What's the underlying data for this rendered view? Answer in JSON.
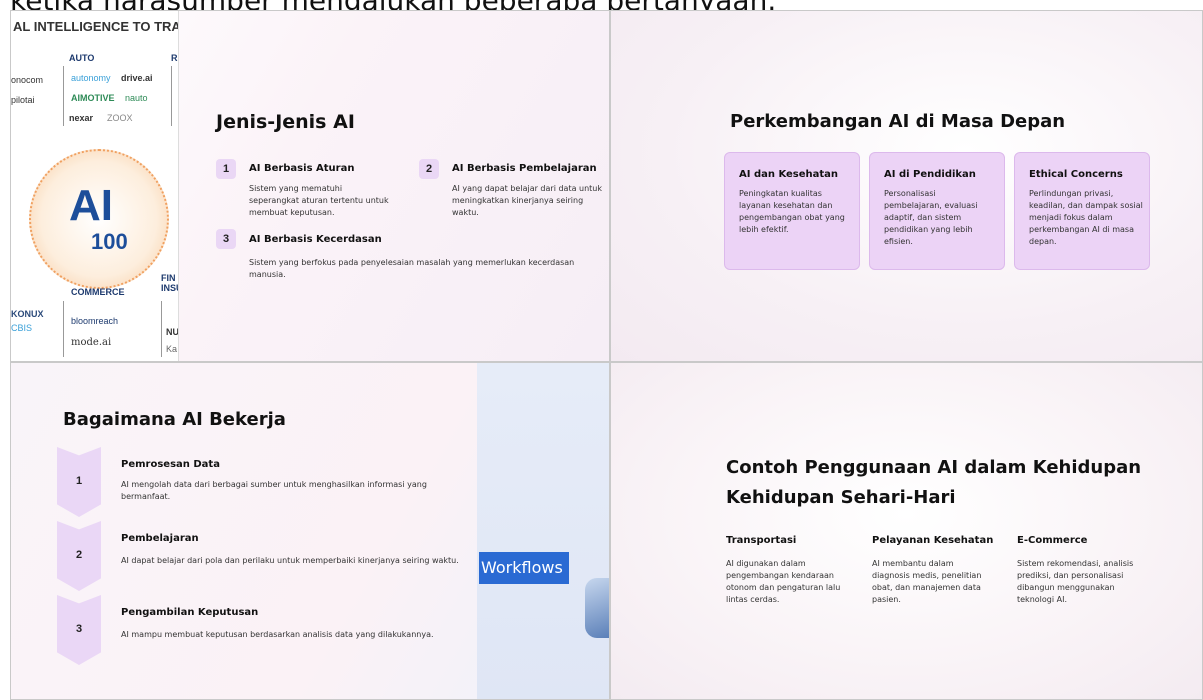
{
  "caption": "ketika narasumber mengajukan beberapa pertanyaan.",
  "slide1": {
    "image": {
      "header": "AL INTELLIGENCE TO TRA",
      "cat_auto": "AUTO",
      "cat_r": "R",
      "cat_commerce": "COMMERCE",
      "cat_fin": "FIN",
      "cat_ins": "INSU",
      "logos": [
        "onocom",
        "pilotai",
        "nexar",
        "autonomy",
        "AIMOTIVE",
        "drive.ai",
        "nauto",
        "ZOOX",
        "KONUX",
        "CBIS",
        "bloomreach",
        "mode.ai",
        "NU",
        "Ka"
      ],
      "ai": "AI",
      "hundred": "100"
    },
    "title": "Jenis-Jenis AI",
    "items": [
      {
        "num": "1",
        "heading": "AI Berbasis Aturan",
        "text": "Sistem yang mematuhi seperangkat aturan tertentu untuk membuat keputusan."
      },
      {
        "num": "2",
        "heading": "AI Berbasis Pembelajaran",
        "text": "AI yang dapat belajar dari data untuk meningkatkan kinerjanya seiring waktu."
      },
      {
        "num": "3",
        "heading": "AI Berbasis Kecerdasan",
        "text": "Sistem yang berfokus pada penyelesaian masalah yang memerlukan kecerdasan manusia."
      }
    ]
  },
  "slide2": {
    "title": "Perkembangan AI di Masa Depan",
    "cards": [
      {
        "heading": "AI dan Kesehatan",
        "text": "Peningkatan kualitas layanan kesehatan dan pengembangan obat yang lebih efektif."
      },
      {
        "heading": "AI di Pendidikan",
        "text": "Personalisasi pembelajaran, evaluasi adaptif, dan sistem pendidikan yang lebih efisien."
      },
      {
        "heading": "Ethical Concerns",
        "text": "Perlindungan privasi, keadilan, dan dampak sosial menjadi fokus dalam perkembangan AI di masa depan."
      }
    ]
  },
  "slide3": {
    "title": "Bagaimana AI Bekerja",
    "steps": [
      {
        "num": "1",
        "heading": "Pemrosesan Data",
        "text": "AI mengolah data dari berbagai sumber untuk menghasilkan informasi yang bermanfaat."
      },
      {
        "num": "2",
        "heading": "Pembelajaran",
        "text": "AI dapat belajar dari pola dan perilaku untuk memperbaiki kinerjanya seiring waktu."
      },
      {
        "num": "3",
        "heading": "Pengambilan Keputusan",
        "text": "AI mampu membuat keputusan berdasarkan analisis data yang dilakukannya."
      }
    ],
    "badge": "Workflows"
  },
  "slide4": {
    "title_line1": "Contoh Penggunaan AI dalam Kehidupan",
    "title_line2": "Kehidupan Sehari-Hari",
    "columns": [
      {
        "heading": "Transportasi",
        "text": "AI digunakan dalam pengembangan kendaraan otonom dan pengaturan lalu lintas cerdas."
      },
      {
        "heading": "Pelayanan Kesehatan",
        "text": "AI membantu dalam diagnosis medis, penelitian obat, dan manajemen data pasien."
      },
      {
        "heading": "E-Commerce",
        "text": "Sistem rekomendasi, analisis prediksi, dan personalisasi dibangun menggunakan teknologi AI."
      }
    ]
  }
}
